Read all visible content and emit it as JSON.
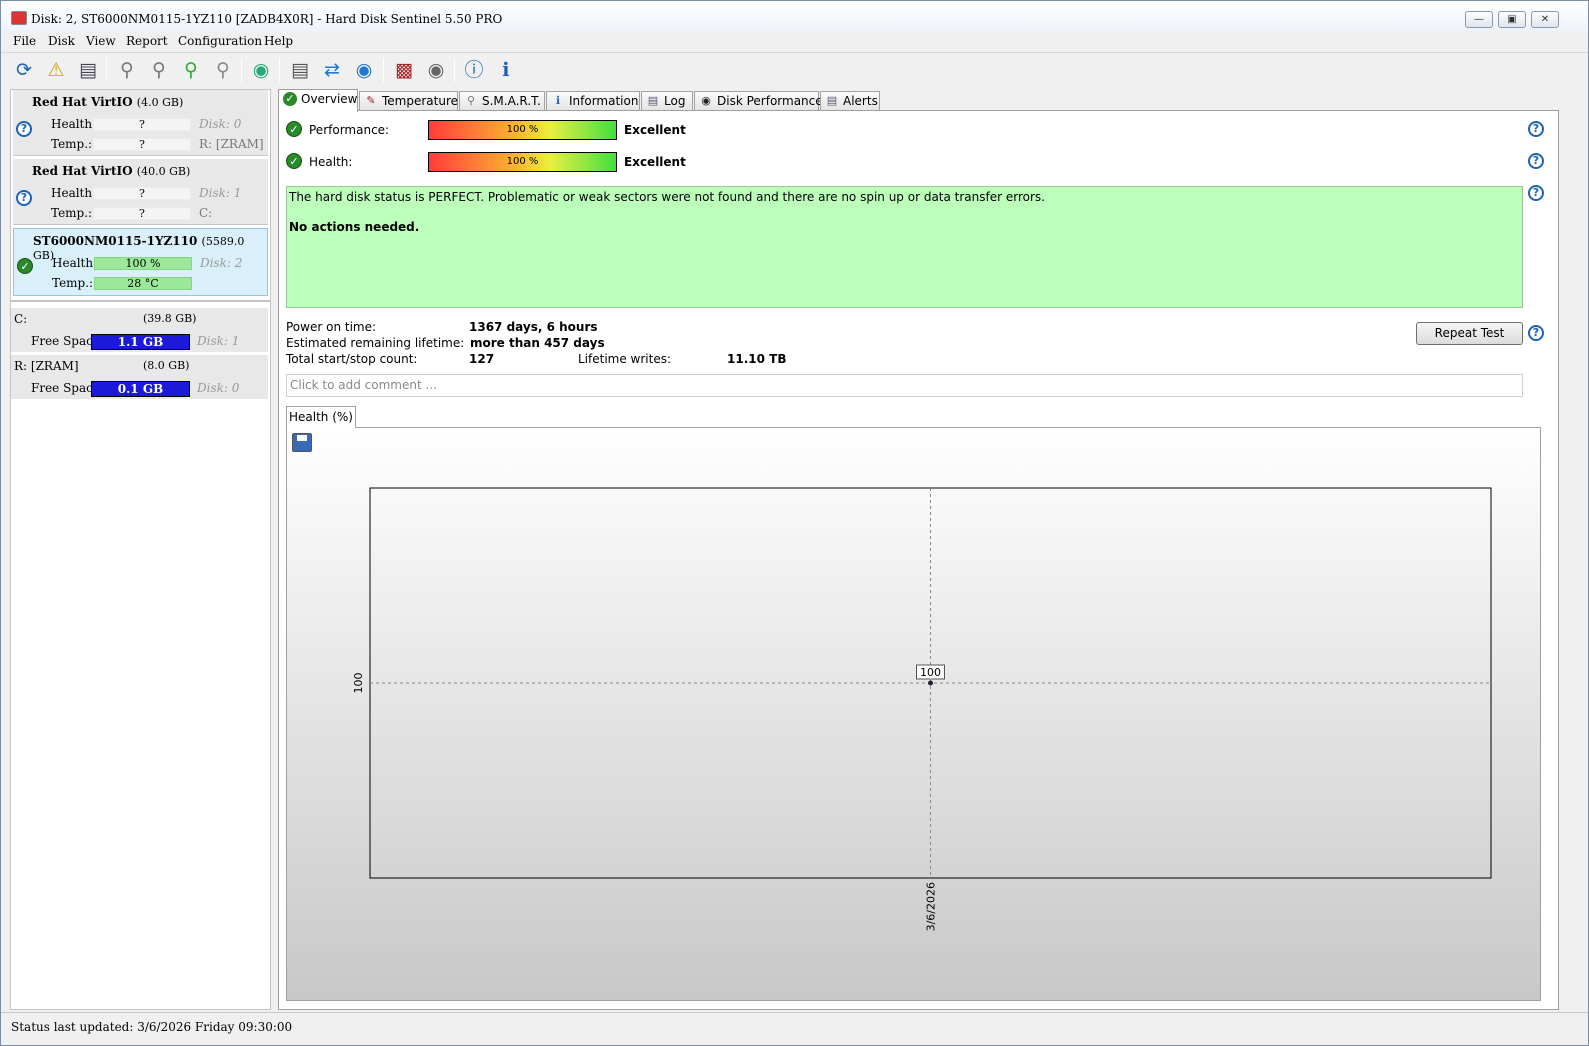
{
  "window": {
    "title": "Disk: 2, ST6000NM0115-1YZ110 [ZADB4X0R]  -  Hard Disk Sentinel 5.50 PRO"
  },
  "menu": [
    "File",
    "Disk",
    "View",
    "Report",
    "Configuration",
    "Help"
  ],
  "disks": [
    {
      "name": "Red Hat VirtIO",
      "size": "(4.0 GB)",
      "health_label": "Health:",
      "health": "?",
      "temp_label": "Temp.:",
      "temp": "?",
      "disk_no": "Disk: 0",
      "drive": "R: [ZRAM]",
      "status_icon": "question-icon"
    },
    {
      "name": "Red Hat VirtIO",
      "size": "(40.0 GB)",
      "health_label": "Health:",
      "health": "?",
      "temp_label": "Temp.:",
      "temp": "?",
      "disk_no": "Disk: 1",
      "drive": "C:",
      "status_icon": "question-icon"
    },
    {
      "name": "ST6000NM0115-1YZ110",
      "size": "(5589.0 GB)",
      "health_label": "Health:",
      "health": "100 %",
      "temp_label": "Temp.:",
      "temp": "28 °C",
      "disk_no": "Disk: 2",
      "drive": "",
      "status_icon": "checkmark-icon"
    }
  ],
  "volumes": [
    {
      "name": "C:",
      "size": "(39.8 GB)",
      "free_label": "Free Space",
      "free": "1.1 GB",
      "disk_no": "Disk: 1"
    },
    {
      "name": "R: [ZRAM]",
      "size": "(8.0 GB)",
      "free_label": "Free Space",
      "free": "0.1 GB",
      "disk_no": "Disk: 0"
    }
  ],
  "tabs": [
    "Overview",
    "Temperature",
    "S.M.A.R.T.",
    "Information",
    "Log",
    "Disk Performance",
    "Alerts"
  ],
  "overview": {
    "performance_label": "Performance:",
    "performance_value": "100 %",
    "performance_rating": "Excellent",
    "health_label": "Health:",
    "health_value": "100 %",
    "health_rating": "Excellent",
    "status_message": "The hard disk status is PERFECT. Problematic or weak sectors were not found and there are no spin up or data transfer errors.",
    "action_message": "No actions needed.",
    "power_on_label": "Power on time:",
    "power_on_value": "1367 days, 6 hours",
    "remaining_label": "Estimated remaining lifetime:",
    "remaining_value": "more than 457 days",
    "startstop_label": "Total start/stop count:",
    "startstop_value": "127",
    "writes_label": "Lifetime writes:",
    "writes_value": "11.10 TB",
    "repeat_button": "Repeat Test",
    "comment_placeholder": "Click to add comment ..."
  },
  "chart_tab": "Health (%)",
  "chart_data": {
    "type": "line",
    "x": [
      "3/6/2026"
    ],
    "series": [
      {
        "values": [
          100
        ]
      }
    ],
    "y_tick_labels": [
      "100"
    ],
    "x_tick_labels": [
      "3/6/2026"
    ],
    "data_labels": [
      "100"
    ]
  },
  "status_bar": "Status last updated: 3/6/2026 Friday 09:30:00",
  "colors": {
    "status_ok": "#bbffbb",
    "free_space": "#1a1ad8",
    "health_green": "#9be89b"
  }
}
